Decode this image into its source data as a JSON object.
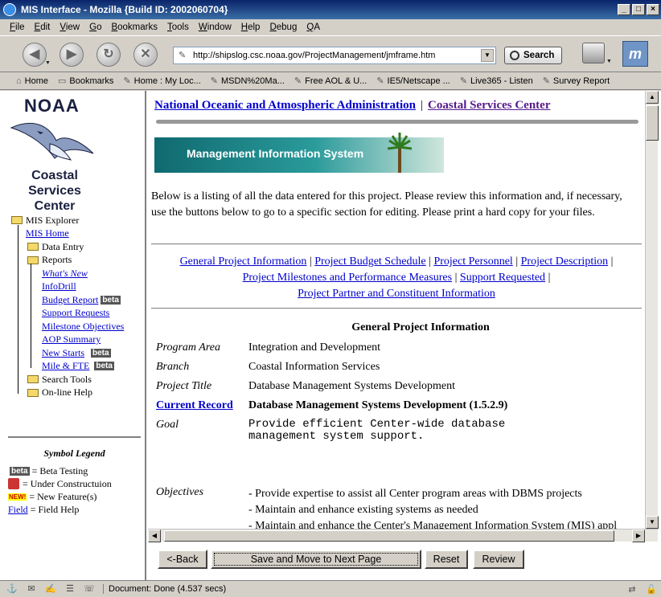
{
  "window": {
    "title": "MIS Interface - Mozilla {Build ID: 2002060704}"
  },
  "menu": [
    "File",
    "Edit",
    "View",
    "Go",
    "Bookmarks",
    "Tools",
    "Window",
    "Help",
    "Debug",
    "QA"
  ],
  "nav": {
    "url": "http://shipslog.csc.noaa.gov/ProjectManagement/jmframe.htm",
    "search_label": "Search"
  },
  "bookmarks": [
    "Home",
    "Bookmarks",
    "Home : My Loc...",
    "MSDN%20Ma...",
    "Free AOL & U...",
    "IE5/Netscape ...",
    "Live365 - Listen",
    "Survey Report"
  ],
  "left": {
    "logo_top": "NOAA",
    "logo_bottom": [
      "Coastal",
      "Services",
      "Center"
    ],
    "tree": {
      "root": "MIS Explorer",
      "home": "MIS Home",
      "data_entry": "Data Entry",
      "reports": "Reports",
      "whats_new": "What's New",
      "infodrill": "InfoDrill",
      "budget_report": "Budget Report",
      "support_requests": "Support Requests",
      "milestone_objectives": "Milestone Objectives",
      "aop_summary": "AOP Summary",
      "new_starts": "New Starts",
      "mile_fte": "Mile & FTE",
      "search_tools": "Search Tools",
      "online_help": "On-line Help",
      "beta_badge": "beta"
    },
    "legend": {
      "title": "Symbol Legend",
      "beta_badge": "beta",
      "beta": "= Beta Testing",
      "under_construction": "= Under Constructuion",
      "new_badge": "NEW!",
      "new_feature": "= New Feature(s)",
      "field_link": "Field",
      "field_help": "= Field Help"
    }
  },
  "main": {
    "top_links": [
      "National Oceanic and Atmospheric Administration",
      "Coastal Services Center"
    ],
    "top_sep": "|",
    "banner": "Management Information System",
    "intro": "Below is a listing of all the data entered for this project. Please review this information and, if necessary, use the buttons below to go to a specific section for editing. Please print a hard copy for your files.",
    "section_links": [
      "General Project Information",
      "Project Budget Schedule",
      "Project Personnel",
      "Project Description",
      "Project Milestones and Performance Measures",
      "Support Requested",
      "Project Partner and Constituent Information"
    ],
    "link_sep": "|",
    "section_heading": "General Project Information",
    "fields": {
      "program_area_label": "Program Area",
      "program_area": "Integration and Development",
      "branch_label": "Branch",
      "branch": "Coastal Information Services",
      "project_title_label": "Project Title",
      "project_title": "Database Management Systems Development",
      "current_record_label": "Current Record",
      "current_record": "Database Management Systems Development  (1.5.2.9)",
      "goal_label": "Goal",
      "goal": "Provide efficient Center-wide database management system support.",
      "objectives_label": "Objectives",
      "objectives": [
        "- Provide expertise to assist all Center program areas with DBMS projects",
        "- Maintain and enhance existing systems as needed",
        "- Maintain and enhance the Center's Management Information System (MIS) appl"
      ]
    },
    "buttons": {
      "back": "<-Back",
      "save_next": "Save and Move to Next Page",
      "reset": "Reset",
      "review": "Review"
    }
  },
  "status": {
    "text": "Document: Done (4.537 secs)"
  }
}
